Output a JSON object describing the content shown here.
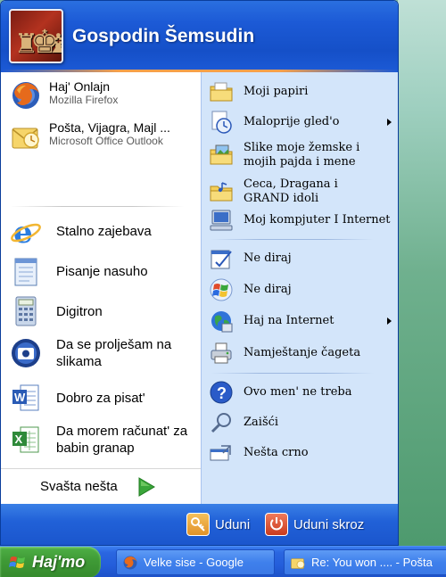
{
  "user": {
    "name": "Gospodin Šemsudin"
  },
  "pinned": [
    {
      "title": "Haj' Onlajn",
      "subtitle": "Mozilla Firefox",
      "icon": "firefox-icon"
    },
    {
      "title": "Pošta, Vijagra, Majl ...",
      "subtitle": "Microsoft Office Outlook",
      "icon": "outlook-icon"
    }
  ],
  "programs": [
    {
      "label": "Stalno zajebava",
      "icon": "internet-explorer-icon"
    },
    {
      "label": "Pisanje nasuho",
      "icon": "notepad-icon"
    },
    {
      "label": "Digitron",
      "icon": "calculator-icon"
    },
    {
      "label": "Da se prolješam na slikama",
      "icon": "picture-viewer-icon"
    },
    {
      "label": "Dobro za pisat'",
      "icon": "word-icon"
    },
    {
      "label": "Da morem računat' za babin granap",
      "icon": "excel-icon"
    }
  ],
  "all_programs": {
    "label": "Svašta nešta"
  },
  "places": [
    {
      "label": "Moji papiri",
      "icon": "folder-icon"
    },
    {
      "label": "Maloprije gled'o",
      "icon": "recent-documents-icon",
      "submenu": true
    },
    {
      "label": "Slike moje žemske i mojih pajda i mene",
      "icon": "pictures-folder-icon"
    },
    {
      "label": "Ceca, Dragana i GRAND idoli",
      "icon": "music-folder-icon"
    },
    {
      "label": "Moj kompjuter I Internet",
      "icon": "computer-icon"
    },
    {
      "label": "Ne diraj",
      "icon": "control-panel-icon"
    },
    {
      "label": "Ne diraj",
      "icon": "windows-logo-icon"
    },
    {
      "label": "Haj na Internet",
      "icon": "globe-icon",
      "submenu": true
    },
    {
      "label": "Namještanje čageta",
      "icon": "printer-icon"
    },
    {
      "label": "Ovo men' ne treba",
      "icon": "help-icon"
    },
    {
      "label": "Zaišći",
      "icon": "search-icon"
    },
    {
      "label": "Nešta crno",
      "icon": "run-icon"
    }
  ],
  "footer": {
    "logoff": "Uduni",
    "shutdown": "Uduni skroz"
  },
  "taskbar": {
    "start": "Haj'mo",
    "tasks": [
      {
        "label": "Velke sise - Google",
        "icon": "firefox-icon"
      },
      {
        "label": "Re: You won .... - Pošta",
        "icon": "outlook-icon"
      }
    ]
  },
  "colors": {
    "header_blue": "#1c5ad6",
    "right_panel": "#d3e5fa",
    "start_green": "#3f9a36",
    "logoff_orange": "#e8a13a",
    "shutdown_red": "#d9452b"
  }
}
